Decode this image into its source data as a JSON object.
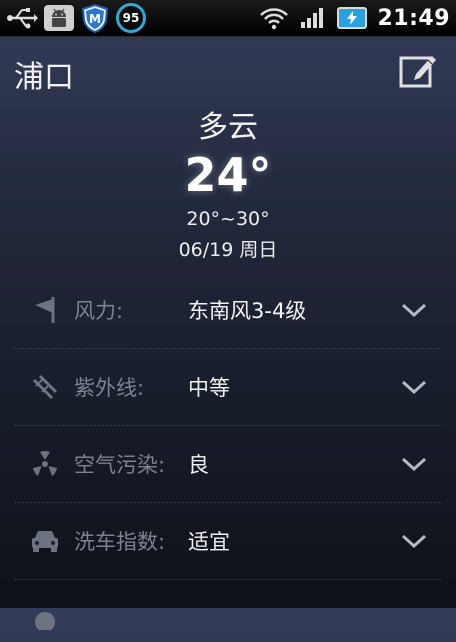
{
  "status_bar": {
    "time": "21:49",
    "badge_number": "95",
    "shield_letter": "M",
    "icons": [
      "usb-icon",
      "android-debug-icon",
      "shield-app-icon",
      "battery-saver-badge",
      "wifi-icon",
      "signal-icon",
      "battery-charging-icon"
    ]
  },
  "header": {
    "city": "浦口",
    "edit_icon": "edit-icon"
  },
  "summary": {
    "condition": "多云",
    "temperature": "24°",
    "range": "20°~30°",
    "date": "06/19 周日"
  },
  "details": [
    {
      "icon": "wind-icon",
      "label": "风力:",
      "value": "东南风3-4级"
    },
    {
      "icon": "uv-icon",
      "label": "紫外线:",
      "value": "中等"
    },
    {
      "icon": "air-pollution-icon",
      "label": "空气污染:",
      "value": "良"
    },
    {
      "icon": "car-wash-icon",
      "label": "洗车指数:",
      "value": "适宜"
    },
    {
      "icon": "partial-icon",
      "label": "",
      "value": ""
    }
  ],
  "colors": {
    "background_top": "#343c5a",
    "background_bottom": "#0e1118",
    "label_gray": "#7d8290",
    "badge_ring": "#2fa8d8",
    "battery_blue": "#2aa0e0"
  }
}
